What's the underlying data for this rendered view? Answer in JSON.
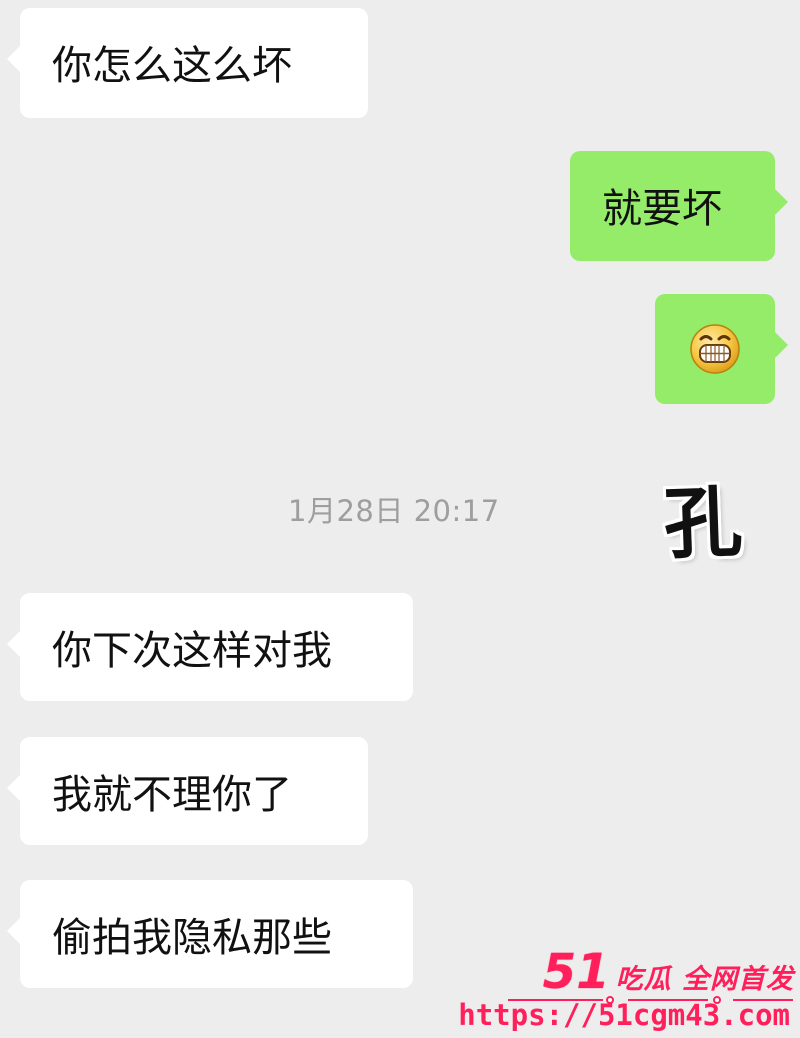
{
  "chat": {
    "messages": [
      {
        "text": "你怎么这么坏",
        "side": "left"
      },
      {
        "text": "就要坏",
        "side": "right"
      },
      {
        "icon": "grinning-face-icon",
        "side": "right"
      },
      {
        "text": "你下次这样对我",
        "side": "left"
      },
      {
        "text": "我就不理你了",
        "side": "left"
      },
      {
        "text": "偷拍我隐私那些",
        "side": "left"
      }
    ],
    "timestamp": "1月28日 20:17",
    "sticker": {
      "text": "孔"
    }
  },
  "watermark": {
    "number": "51",
    "title": "吃瓜 全网首发",
    "url": "https://51cgm43.com"
  },
  "colors": {
    "background": "#ededed",
    "incoming_bubble": "#ffffff",
    "outgoing_bubble": "#95ec69",
    "timestamp": "#9e9e9e",
    "watermark": "#ff1f5b"
  }
}
